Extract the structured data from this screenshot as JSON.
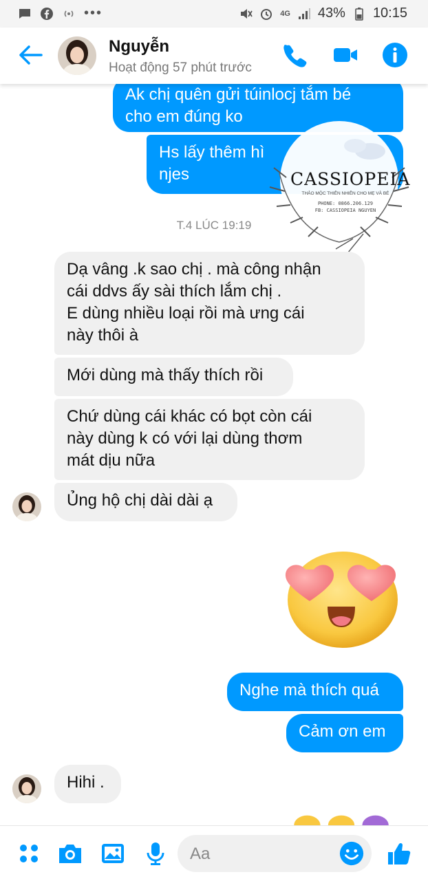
{
  "status_bar": {
    "battery": "43%",
    "time": "10:15",
    "network": "4G"
  },
  "header": {
    "name": "Nguyễn",
    "status": "Hoạt động 57 phút trước"
  },
  "watermark": {
    "brand": "CASSIOPEIA",
    "tagline": "THẢO MỘC THIÊN NHIÊN CHO MẸ VÀ BÉ",
    "phone": "PHONE: 0866.206.129",
    "fb": "FB: CASSIOPEIA NGUYEN"
  },
  "messages": {
    "m1": "Ak chị quên gửi túinlocj tắm bé\ncho em đúng ko",
    "m2": "Hs lấy thêm hì\nnjes",
    "timestamp": "T.4 LÚC 19:19",
    "m3": "Dạ vâng .k sao chị . mà công nhận\ncái ddvs ấy sài thích lắm chị .\nE dùng nhiều loại rồi mà ưng cái\nnày thôi à",
    "m4": "Mới dùng mà thấy thích rồi",
    "m5": "Chứ dùng cái khác có bọt còn cái\nnày dùng k có với lại dùng thơm\nmát dịu nữa",
    "m6": "Ủng hộ chị dài dài ạ",
    "m7": "Nghe mà thích quá",
    "m8": "Cảm ơn em",
    "m9": "Hihi ."
  },
  "composer": {
    "placeholder": "Aa"
  },
  "colors": {
    "accent": "#0099ff",
    "incoming": "#f0f0f0"
  }
}
